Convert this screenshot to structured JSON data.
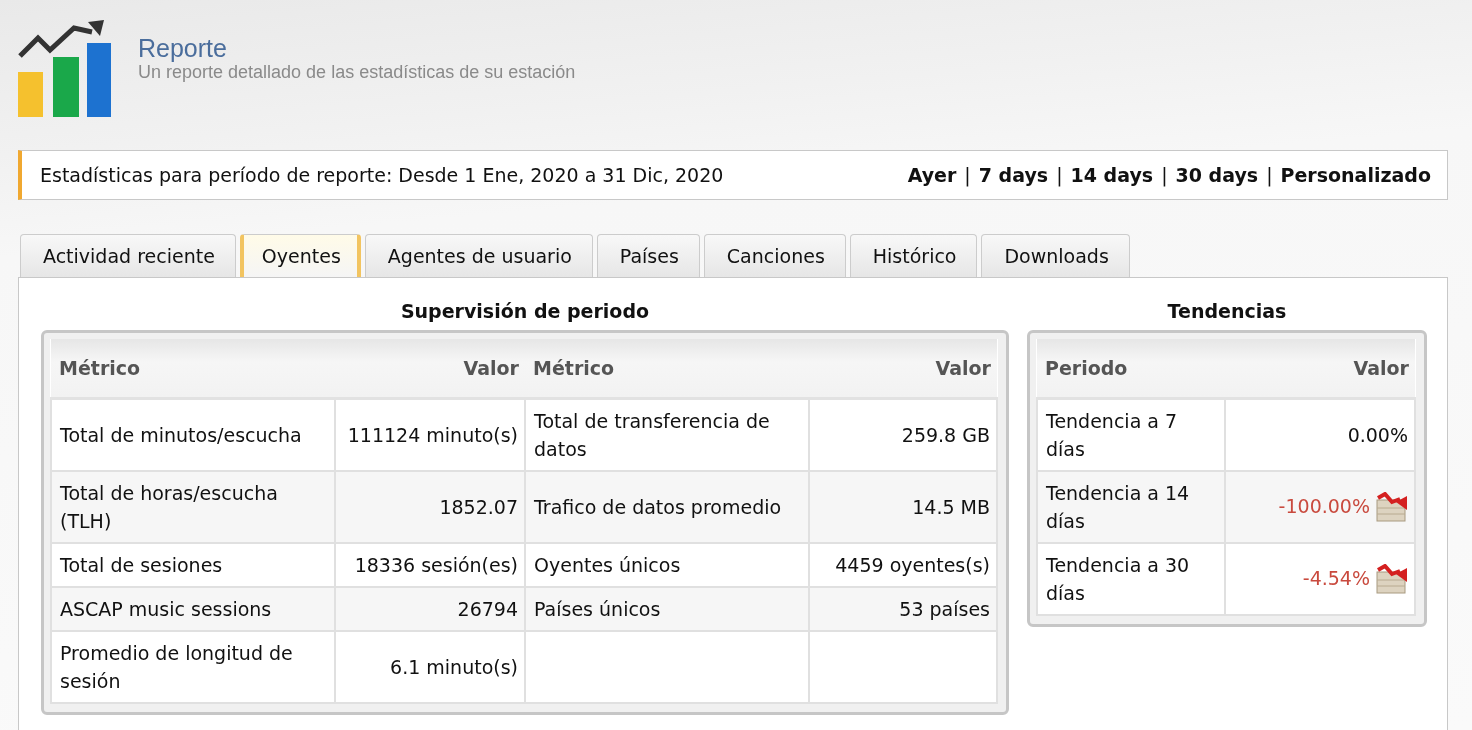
{
  "header": {
    "title": "Reporte",
    "subtitle": "Un reporte detallado de las estadísticas de su estación"
  },
  "period_bar": {
    "text": "Estadísticas para período de reporte: Desde 1 Ene, 2020 a 31 Dic, 2020",
    "separator": "|",
    "links": [
      "Ayer",
      "7 days",
      "14 days",
      "30 days",
      "Personalizado"
    ]
  },
  "tabs": [
    {
      "label": "Actividad reciente",
      "selected": false
    },
    {
      "label": "Oyentes",
      "selected": true
    },
    {
      "label": "Agentes de usuario",
      "selected": false
    },
    {
      "label": "Países",
      "selected": false
    },
    {
      "label": "Canciones",
      "selected": false
    },
    {
      "label": "Histórico",
      "selected": false
    },
    {
      "label": "Downloads",
      "selected": false
    }
  ],
  "overview": {
    "title": "Supervisión de periodo",
    "columns": [
      "Métrico",
      "Valor",
      "Métrico",
      "Valor"
    ],
    "rows": [
      [
        "Total de minutos/escucha",
        "111124 minuto(s)",
        "Total de transferencia de datos",
        "259.8 GB"
      ],
      [
        "Total de horas/escucha (TLH)",
        "1852.07",
        "Trafico de datos promedio",
        "14.5 MB"
      ],
      [
        "Total de sesiones",
        "18336 sesión(es)",
        "Oyentes únicos",
        "4459 oyentes(s)"
      ],
      [
        "ASCAP music sessions",
        "26794",
        "Países únicos",
        "53 países"
      ],
      [
        "Promedio de longitud de sesión",
        "6.1 minuto(s)"
      ]
    ]
  },
  "trends": {
    "title": "Tendencias",
    "columns": [
      "Periodo",
      "Valor"
    ],
    "rows": [
      {
        "period": "Tendencia a 7 días",
        "value": "0.00%",
        "kind": "flat"
      },
      {
        "period": "Tendencia a 14 días",
        "value": "-100.00%",
        "kind": "down"
      },
      {
        "period": "Tendencia a 30 días",
        "value": "-4.54%",
        "kind": "down"
      }
    ]
  }
}
